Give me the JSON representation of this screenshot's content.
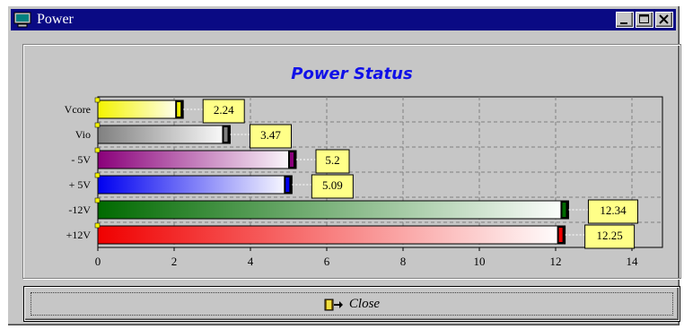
{
  "window": {
    "title": "Power",
    "icon": "monitor-icon",
    "controls": [
      "minimize-icon",
      "maximize-icon",
      "close-icon"
    ]
  },
  "chart_title": "Power Status",
  "chart_data": {
    "type": "bar",
    "orientation": "horizontal",
    "title": "Power Status",
    "categories": [
      "Vcore",
      "Vio",
      "- 5V",
      "+ 5V",
      "-12V",
      "+12V"
    ],
    "values": [
      2.24,
      3.47,
      5.2,
      5.09,
      12.34,
      12.25
    ],
    "value_labels": [
      "2.24",
      "3.47",
      "5.2",
      "5.09",
      "12.34",
      "12.25"
    ],
    "colors": [
      "#f4f400",
      "#808080",
      "#8a007a",
      "#0000f0",
      "#006a00",
      "#f00000"
    ],
    "xlim": [
      0,
      14.8
    ],
    "x_ticks": [
      0,
      2,
      4,
      6,
      8,
      10,
      12,
      14
    ],
    "grid": true
  },
  "close_button": {
    "label": "Close",
    "icon": "door-exit-icon"
  }
}
